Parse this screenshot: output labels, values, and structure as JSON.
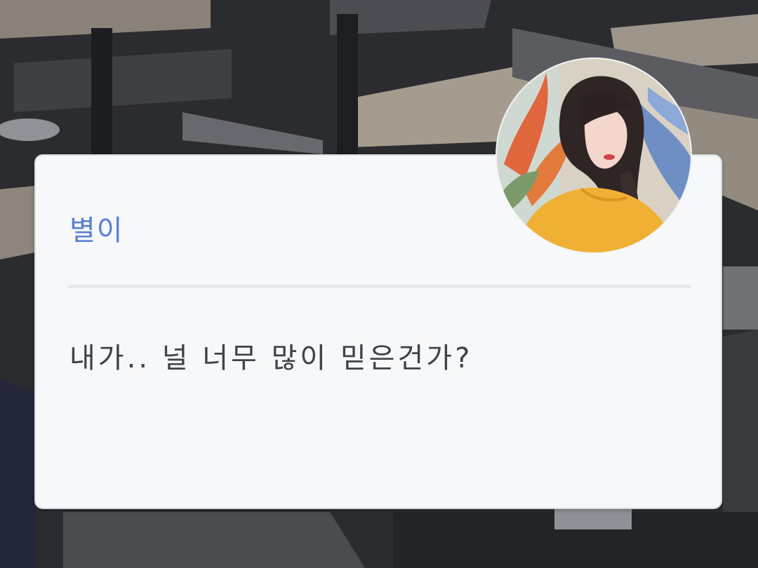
{
  "dialog": {
    "speaker_name": "별이",
    "message": "내가.. 널 너무 많이 믿은건가?"
  },
  "avatar": {
    "icon": "profile-portrait"
  },
  "colors": {
    "speaker": "#5c7fd6",
    "message": "#3f4246",
    "panel": "#f6f8fa"
  }
}
